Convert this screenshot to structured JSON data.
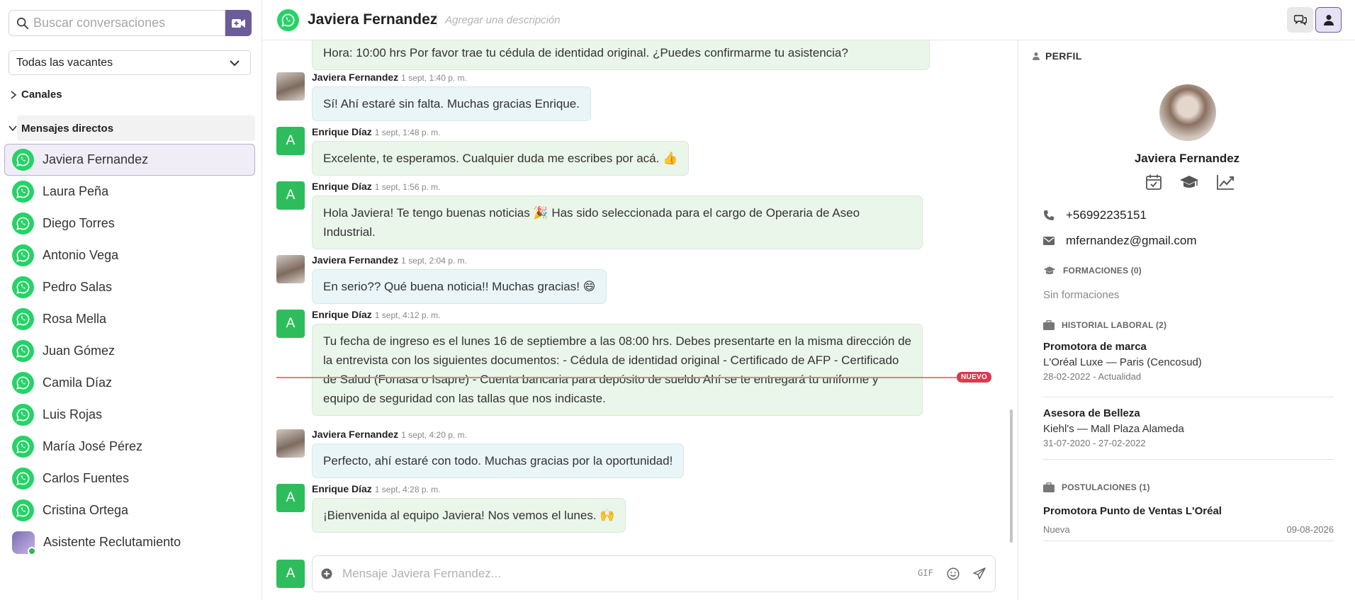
{
  "search": {
    "placeholder": "Buscar conversaciones"
  },
  "filter": {
    "selected": "Todas las vacantes"
  },
  "sections": {
    "channels": "Canales",
    "direct_messages": "Mensajes directos"
  },
  "contacts": [
    "Javiera Fernandez",
    "Laura Peña",
    "Diego Torres",
    "Antonio Vega",
    "Pedro Salas",
    "Rosa Mella",
    "Juan Gómez",
    "Camila Díaz",
    "Luis Rojas",
    "María José Pérez",
    "Carlos Fuentes",
    "Cristina Ortega",
    "Asistente Reclutamiento"
  ],
  "header": {
    "title": "Javiera Fernandez",
    "description_placeholder": "Agregar una descripción"
  },
  "messages": {
    "m0": {
      "text": "Hora: 10:00 hrs Por favor trae tu cédula de identidad original. ¿Puedes confirmarme tu asistencia?"
    },
    "m1": {
      "author": "Javiera Fernandez",
      "time": "1 sept, 1:40 p. m.",
      "text": "Sí! Ahí estaré sin falta. Muchas gracias Enrique."
    },
    "m2": {
      "author": "Enrique Díaz",
      "time": "1 sept, 1:48 p. m.",
      "text": "Excelente, te esperamos. Cualquier duda me escribes por acá. 👍"
    },
    "m3": {
      "author": "Enrique Díaz",
      "time": "1 sept, 1:56 p. m.",
      "text": "Hola Javiera! Te tengo buenas noticias 🎉 Has sido seleccionada para el cargo de Operaria de Aseo Industrial."
    },
    "m4": {
      "author": "Javiera Fernandez",
      "time": "1 sept, 2:04 p. m.",
      "text": "En serio?? Qué buena noticia!! Muchas gracias! 😄"
    },
    "m5": {
      "author": "Enrique Díaz",
      "time": "1 sept, 4:12 p. m.",
      "text": "Tu fecha de ingreso es el lunes 16 de septiembre a las 08:00 hrs. Debes presentarte en la misma dirección de la entrevista con los siguientes documentos: - Cédula de identidad original - Certificado de AFP - Certificado de Salud (Fonasa o Isapre) - Cuenta bancaria para depósito de sueldo Ahí se te entregará tu uniforme y equipo de seguridad con las tallas que nos indicaste."
    },
    "m6": {
      "author": "Javiera Fernandez",
      "time": "1 sept, 4:20 p. m.",
      "text": "Perfecto, ahí estaré con todo. Muchas gracias por la oportunidad!"
    },
    "m7": {
      "author": "Enrique Díaz",
      "time": "1 sept, 4:28 p. m.",
      "text": "¡Bienvenida al equipo Javiera! Nos vemos el lunes. 🙌"
    }
  },
  "avatar_letter": "A",
  "new_badge": "NUEVO",
  "composer": {
    "placeholder": "Mensaje Javiera Fernandez...",
    "gif_label": "GIF"
  },
  "profile": {
    "heading": "PERFIL",
    "name": "Javiera Fernandez",
    "phone": "+56992235151",
    "email": "mfernandez@gmail.com",
    "trainings_heading": "FORMACIONES (0)",
    "trainings_empty": "Sin formaciones",
    "work_heading": "HISTORIAL LABORAL (2)",
    "jobs": [
      {
        "title": "Promotora de marca",
        "company": "L'Oréal Luxe — Paris (Cencosud)",
        "dates": "28-02-2022 - Actualidad"
      },
      {
        "title": "Asesora de Belleza",
        "company": "Kiehl's — Mall Plaza Alameda",
        "dates": "31-07-2020 - 27-02-2022"
      }
    ],
    "applications_heading": "POSTULACIONES (1)",
    "applications": [
      {
        "title": "Promotora Punto de Ventas L'Oréal",
        "status": "Nueva",
        "date": "09-08-2026"
      }
    ]
  },
  "colors": {
    "accent": "#6b5b9a",
    "whatsapp": "#25d366",
    "new_marker": "#d93a4e"
  }
}
